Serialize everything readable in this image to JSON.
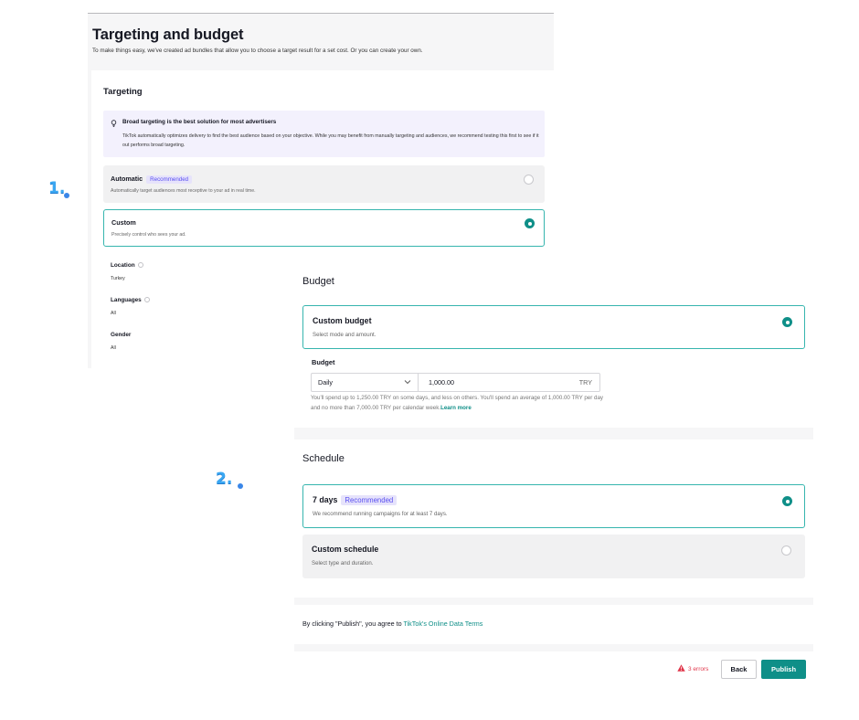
{
  "targeting_panel": {
    "title": "Targeting and budget",
    "subtitle": "To make things easy, we've created ad bundles that allow you to choose a target result for a set cost. Or you can create your own.",
    "section_title": "Targeting",
    "notice": {
      "icon": "lightbulb-icon",
      "title": "Broad targeting is the best solution for most advertisers",
      "body": "TikTok automatically optimizes delivery to find the best audience based on your objective. While you may benefit from manually targeting and audiences, we recommend testing this first to see if it out performs broad targeting."
    },
    "options": [
      {
        "label": "Automatic",
        "badge": "Recommended",
        "description": "Automatically target audiences most receptive to your ad in real time.",
        "selected": false
      },
      {
        "label": "Custom",
        "description": "Precisely control who sees your ad.",
        "selected": true
      }
    ],
    "fields": [
      {
        "label": "Location",
        "value": "Turkey",
        "info_icon": true
      },
      {
        "label": "Languages",
        "value": "All",
        "info_icon": true
      },
      {
        "label": "Gender",
        "value": "All",
        "info_icon": false
      }
    ]
  },
  "markers": {
    "one": "1.",
    "two": "2."
  },
  "budget_panel": {
    "title": "Budget",
    "option": {
      "label": "Custom budget",
      "description": "Select mode and amount.",
      "selected": true
    },
    "budget_label": "Budget",
    "mode": "Daily",
    "amount": "1,000.00",
    "currency": "TRY",
    "help_text": "You'll spend up to 1,250.00 TRY on some days, and less on others. You'll spend an average of 1,000.00 TRY per day and no more than 7,000.00 TRY per calendar week.",
    "learn_more": "Learn more"
  },
  "schedule_panel": {
    "title": "Schedule",
    "options": [
      {
        "label": "7 days",
        "badge": "Recommended",
        "description": "We recommend running campaigns for at least 7 days.",
        "selected": true
      },
      {
        "label": "Custom schedule",
        "description": "Select type and duration.",
        "selected": false
      }
    ]
  },
  "terms": {
    "prefix": "By clicking \"Publish\", you agree to ",
    "link": "TikTok's Online Data Terms"
  },
  "footer": {
    "errors": "3 errors",
    "back_label": "Back",
    "publish_label": "Publish"
  },
  "colors": {
    "accent": "#0f8f88",
    "selected_border": "#36b5ae",
    "badge_bg": "#e6e3fb",
    "badge_text": "#5a4ff0",
    "error": "#e0364a",
    "marker": "#3aa7f2"
  }
}
